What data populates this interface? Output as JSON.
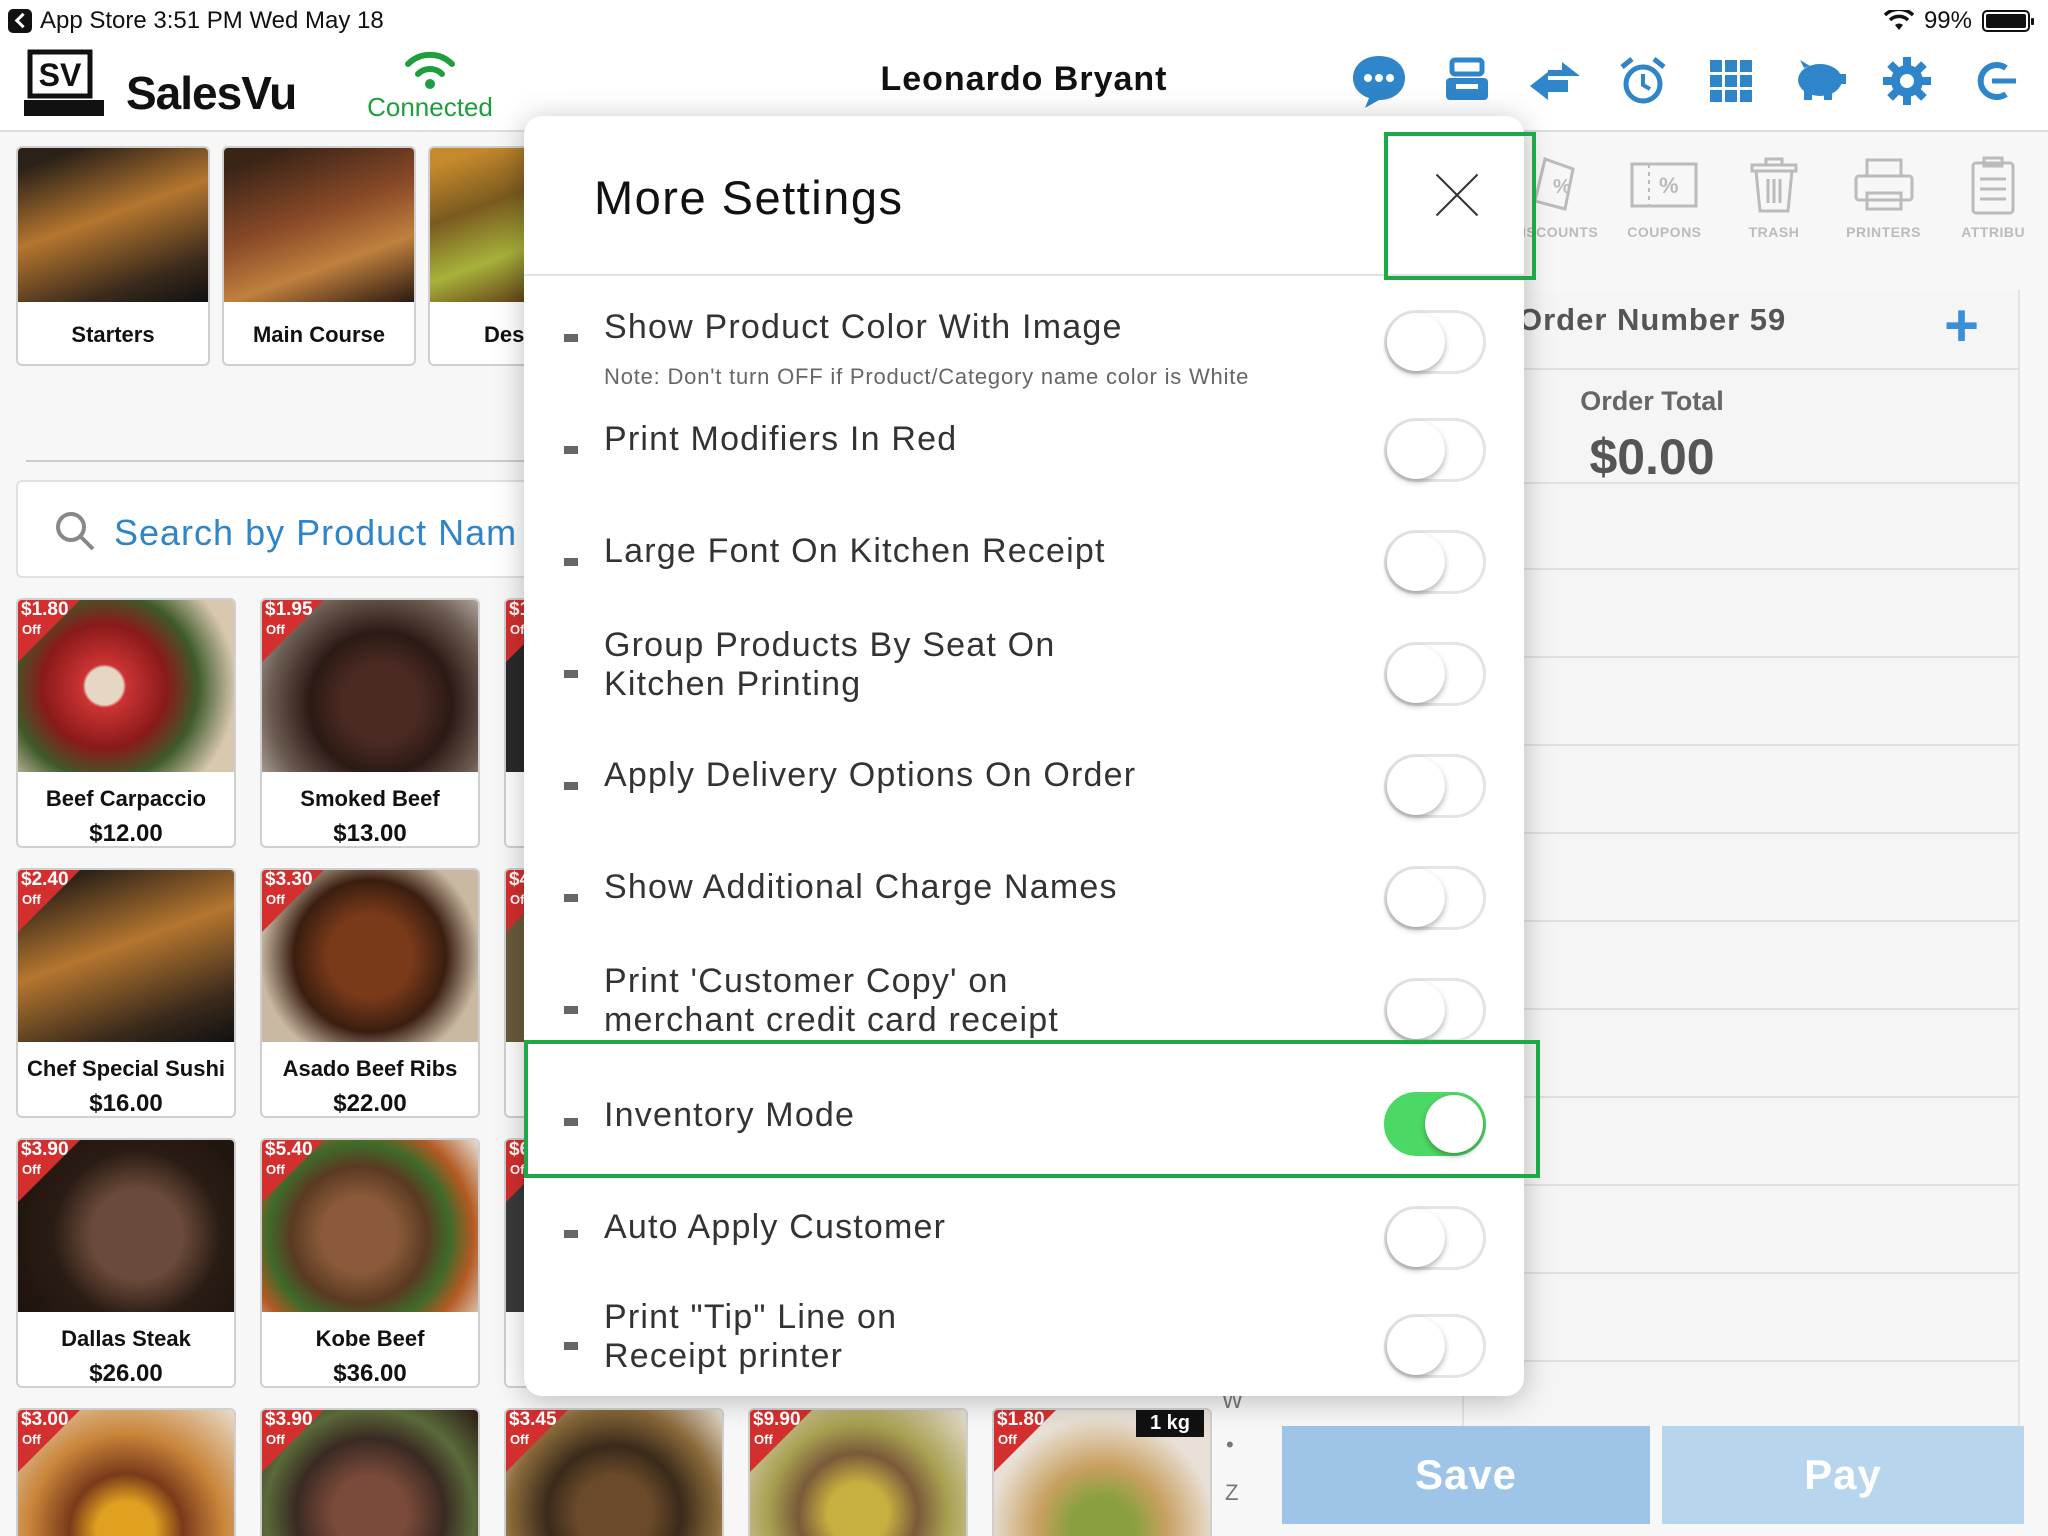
{
  "status_bar": {
    "left": "App Store  3:51 PM   Wed May 18",
    "battery": "99%"
  },
  "header": {
    "logo_text": "SalesVu",
    "logo_badge": "SV",
    "connection": "Connected",
    "user_name": "Leonardo Bryant",
    "icons": [
      "chat-icon",
      "register-icon",
      "transfer-icon",
      "alarm-icon",
      "grid-icon",
      "piggy-bank-icon",
      "gear-icon",
      "logout-icon"
    ]
  },
  "categories": [
    {
      "label": "Starters"
    },
    {
      "label": "Main Course"
    },
    {
      "label": "Des"
    }
  ],
  "search": {
    "placeholder": "Search by Product Nam"
  },
  "products": [
    {
      "name": "Beef Carpaccio",
      "price": "$12.00",
      "discount": "$1.80",
      "off": "Off"
    },
    {
      "name": "Smoked Beef",
      "price": "$13.00",
      "discount": "$1.95",
      "off": "Off"
    },
    {
      "name": "Chef Special Sushi",
      "price": "$16.00",
      "discount": "$2.40",
      "off": "Off"
    },
    {
      "name": "Asado Beef Ribs",
      "price": "$22.00",
      "discount": "$3.30",
      "off": "Off"
    },
    {
      "name": "Dallas Steak",
      "price": "$26.00",
      "discount": "$3.90",
      "off": "Off"
    },
    {
      "name": "Kobe Beef",
      "price": "$36.00",
      "discount": "$5.40",
      "off": "Off"
    }
  ],
  "partial_column": [
    {
      "discount": "$1",
      "off": "Of"
    },
    {
      "discount": "$4",
      "off": "Of"
    },
    {
      "discount": "$6",
      "off": "Of"
    }
  ],
  "bottom_row": [
    {
      "discount": "$3.00",
      "off": "Off"
    },
    {
      "discount": "$3.90",
      "off": "Off"
    },
    {
      "discount": "$3.45",
      "off": "Off"
    },
    {
      "discount": "$9.90",
      "off": "Off"
    },
    {
      "discount": "$1.80",
      "off": "Off",
      "badge": "1 kg"
    }
  ],
  "alpha_index": [
    "W",
    "•",
    "Z"
  ],
  "toolbar": [
    {
      "label": "DISCOUNTS",
      "icon": "discount-tag-icon"
    },
    {
      "label": "COUPONS",
      "icon": "coupon-icon"
    },
    {
      "label": "TRASH",
      "icon": "trash-icon"
    },
    {
      "label": "PRINTERS",
      "icon": "printer-icon"
    },
    {
      "label": "ATTRIBU",
      "icon": "clipboard-icon"
    }
  ],
  "order": {
    "number_label": "Order Number 59",
    "total_label": "Order Total",
    "total_value": "$0.00",
    "save_label": "Save",
    "pay_label": "Pay"
  },
  "modal": {
    "title": "More Settings",
    "settings": [
      {
        "label": "Show Product Color With Image",
        "note": "Note: Don't turn OFF if Product/Category name color is White",
        "on": false
      },
      {
        "label": "Print Modifiers In Red",
        "on": false
      },
      {
        "label": "Large Font On Kitchen Receipt",
        "on": false
      },
      {
        "label": "Group Products By Seat On\nKitchen Printing",
        "on": false
      },
      {
        "label": "Apply Delivery Options On Order",
        "on": false
      },
      {
        "label": "Show Additional Charge Names",
        "on": false
      },
      {
        "label": "Print 'Customer Copy' on\nmerchant credit card receipt",
        "on": false
      },
      {
        "label": "Inventory Mode",
        "on": true
      },
      {
        "label": "Auto Apply Customer",
        "on": false
      },
      {
        "label": "Print \"Tip\" Line on\nReceipt printer",
        "on": false
      }
    ]
  },
  "colors": {
    "connected": "#1e9e3c",
    "accent_blue": "#2f85c9",
    "toggle_on": "#4cd864",
    "highlight": "#1fa848",
    "discount_tag": "#d32f2f"
  }
}
